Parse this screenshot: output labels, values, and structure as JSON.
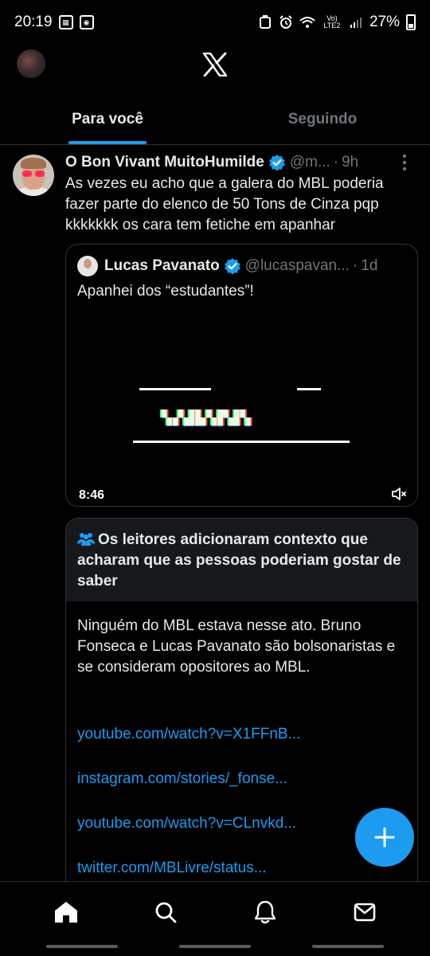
{
  "status": {
    "time": "20:19",
    "network": "Vo) LTE2",
    "battery": "27%"
  },
  "header": {
    "logo_icon": "x-logo-icon"
  },
  "tabs": [
    {
      "label": "Para você",
      "active": true
    },
    {
      "label": "Seguindo",
      "active": false
    }
  ],
  "tweet": {
    "display_name": "O Bon Vivant MuitoHumilde",
    "handle": "@m...",
    "separator": "·",
    "time": "9h",
    "text": "As vezes eu acho que a galera do MBL poderia fazer parte do elenco de 50 Tons de Cinza pqp kkkkkkk os cara tem fetiche em apanhar",
    "quote": {
      "display_name": "Lucas Pavanato",
      "handle": "@lucaspavan...",
      "separator": "·",
      "time": "1d",
      "text": "Apanhei dos “estudantes”!",
      "video_duration": "8:46"
    },
    "note": {
      "title": "Os leitores adicionaram contexto que acharam que as pessoas poderiam gostar de saber",
      "body": "Ninguém do MBL estava nesse ato. Bruno Fonseca e Lucas Pavanato são bolsonaristas e se consideram opositores ao MBL.",
      "links": [
        "youtube.com/watch?v=X1FFnB...",
        "instagram.com/stories/_fonse...",
        "youtube.com/watch?v=CLnvkd...",
        "twitter.com/MBLivre/status..."
      ]
    }
  },
  "colors": {
    "accent": "#1d9bf0",
    "background": "#000000",
    "secondary_text": "#71767b"
  }
}
